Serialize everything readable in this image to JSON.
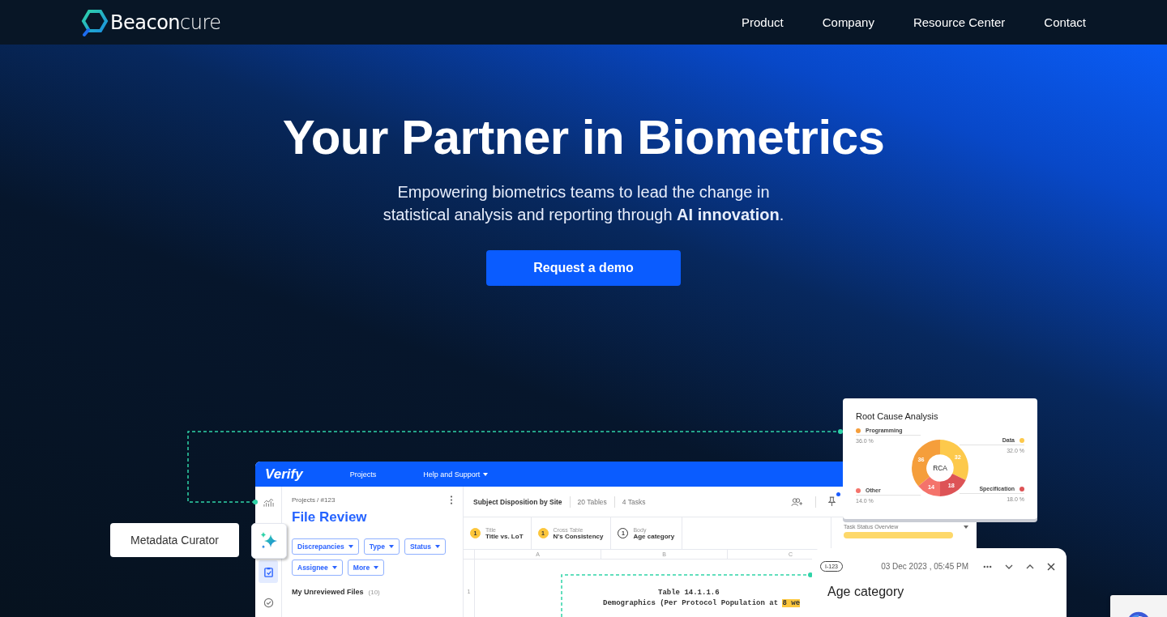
{
  "nav": {
    "logo": "**Beacon**cure",
    "links": [
      "Product",
      "Company",
      "Resource Center",
      "Contact"
    ]
  },
  "hero": {
    "title": "Your Partner in Biometrics",
    "subtitle": "Empowering biometrics teams to lead the change in statistical analysis and reporting through **AI innovation**.",
    "button": "Request a demo"
  },
  "app": {
    "brand": "Verify",
    "menu": [
      {
        "label": "Projects",
        "dropdown": false
      },
      {
        "label": "Help and Support",
        "dropdown": true
      }
    ],
    "rail": [
      {
        "kind": "chart",
        "selected": false
      },
      {
        "kind": "clipboard",
        "selected": true
      },
      {
        "kind": "check",
        "selected": false
      }
    ],
    "breadcrumb": "Projects / #123",
    "page_title": "File Review",
    "filters": [
      "Discrepancies",
      "Type",
      "Status",
      "Assignee",
      "More"
    ],
    "section": {
      "label": "My Unreviewed Files",
      "count": "(10)"
    },
    "header": {
      "title": "Subject Disposition by Site",
      "tables": "20 Tables",
      "tasks": "4 Tasks",
      "notification": true
    },
    "issues": [
      {
        "count": "1",
        "category": "Title",
        "name": "Title vs. LoT",
        "highlighted": true
      },
      {
        "count": "1",
        "category": "Cross Table",
        "name": "N's Consistency",
        "highlighted": true
      },
      {
        "count": "1",
        "category": "Body",
        "name": "Age category",
        "highlighted": false
      }
    ],
    "task_status": {
      "label": "Task Status Overview"
    },
    "columns": [
      "A",
      "B",
      "C"
    ],
    "row_number": "1",
    "table_title": "Table 14.1.1.6",
    "table_subtitle": "Demographics (Per Protocol Population at",
    "table_highlight": "8 we"
  },
  "tooltip": "Metadata Curator",
  "rca": {
    "title": "Root Cause Analysis",
    "legend_left": [
      {
        "name": "Programming",
        "percent": "36.0 %",
        "color": "#f59e3b"
      },
      {
        "name": "Other",
        "percent": "14.0 %",
        "color": "#f4736b"
      }
    ],
    "legend_right": [
      {
        "name": "Data",
        "percent": "32.0 %",
        "color": "#fdc94b"
      },
      {
        "name": "Specification",
        "percent": "18.0 %",
        "color": "#dd5356"
      }
    ],
    "chart_data": {
      "type": "donut",
      "title": "RCA",
      "values": [
        32,
        18,
        14,
        36
      ],
      "colors": [
        "#fdc94b",
        "#dd5356",
        "#f4736b",
        "#f59e3b"
      ],
      "data_labels": true
    }
  },
  "comment": {
    "id": "I-123",
    "date": "03 Dec 2023 , 05:45 PM",
    "title": "Age category"
  }
}
